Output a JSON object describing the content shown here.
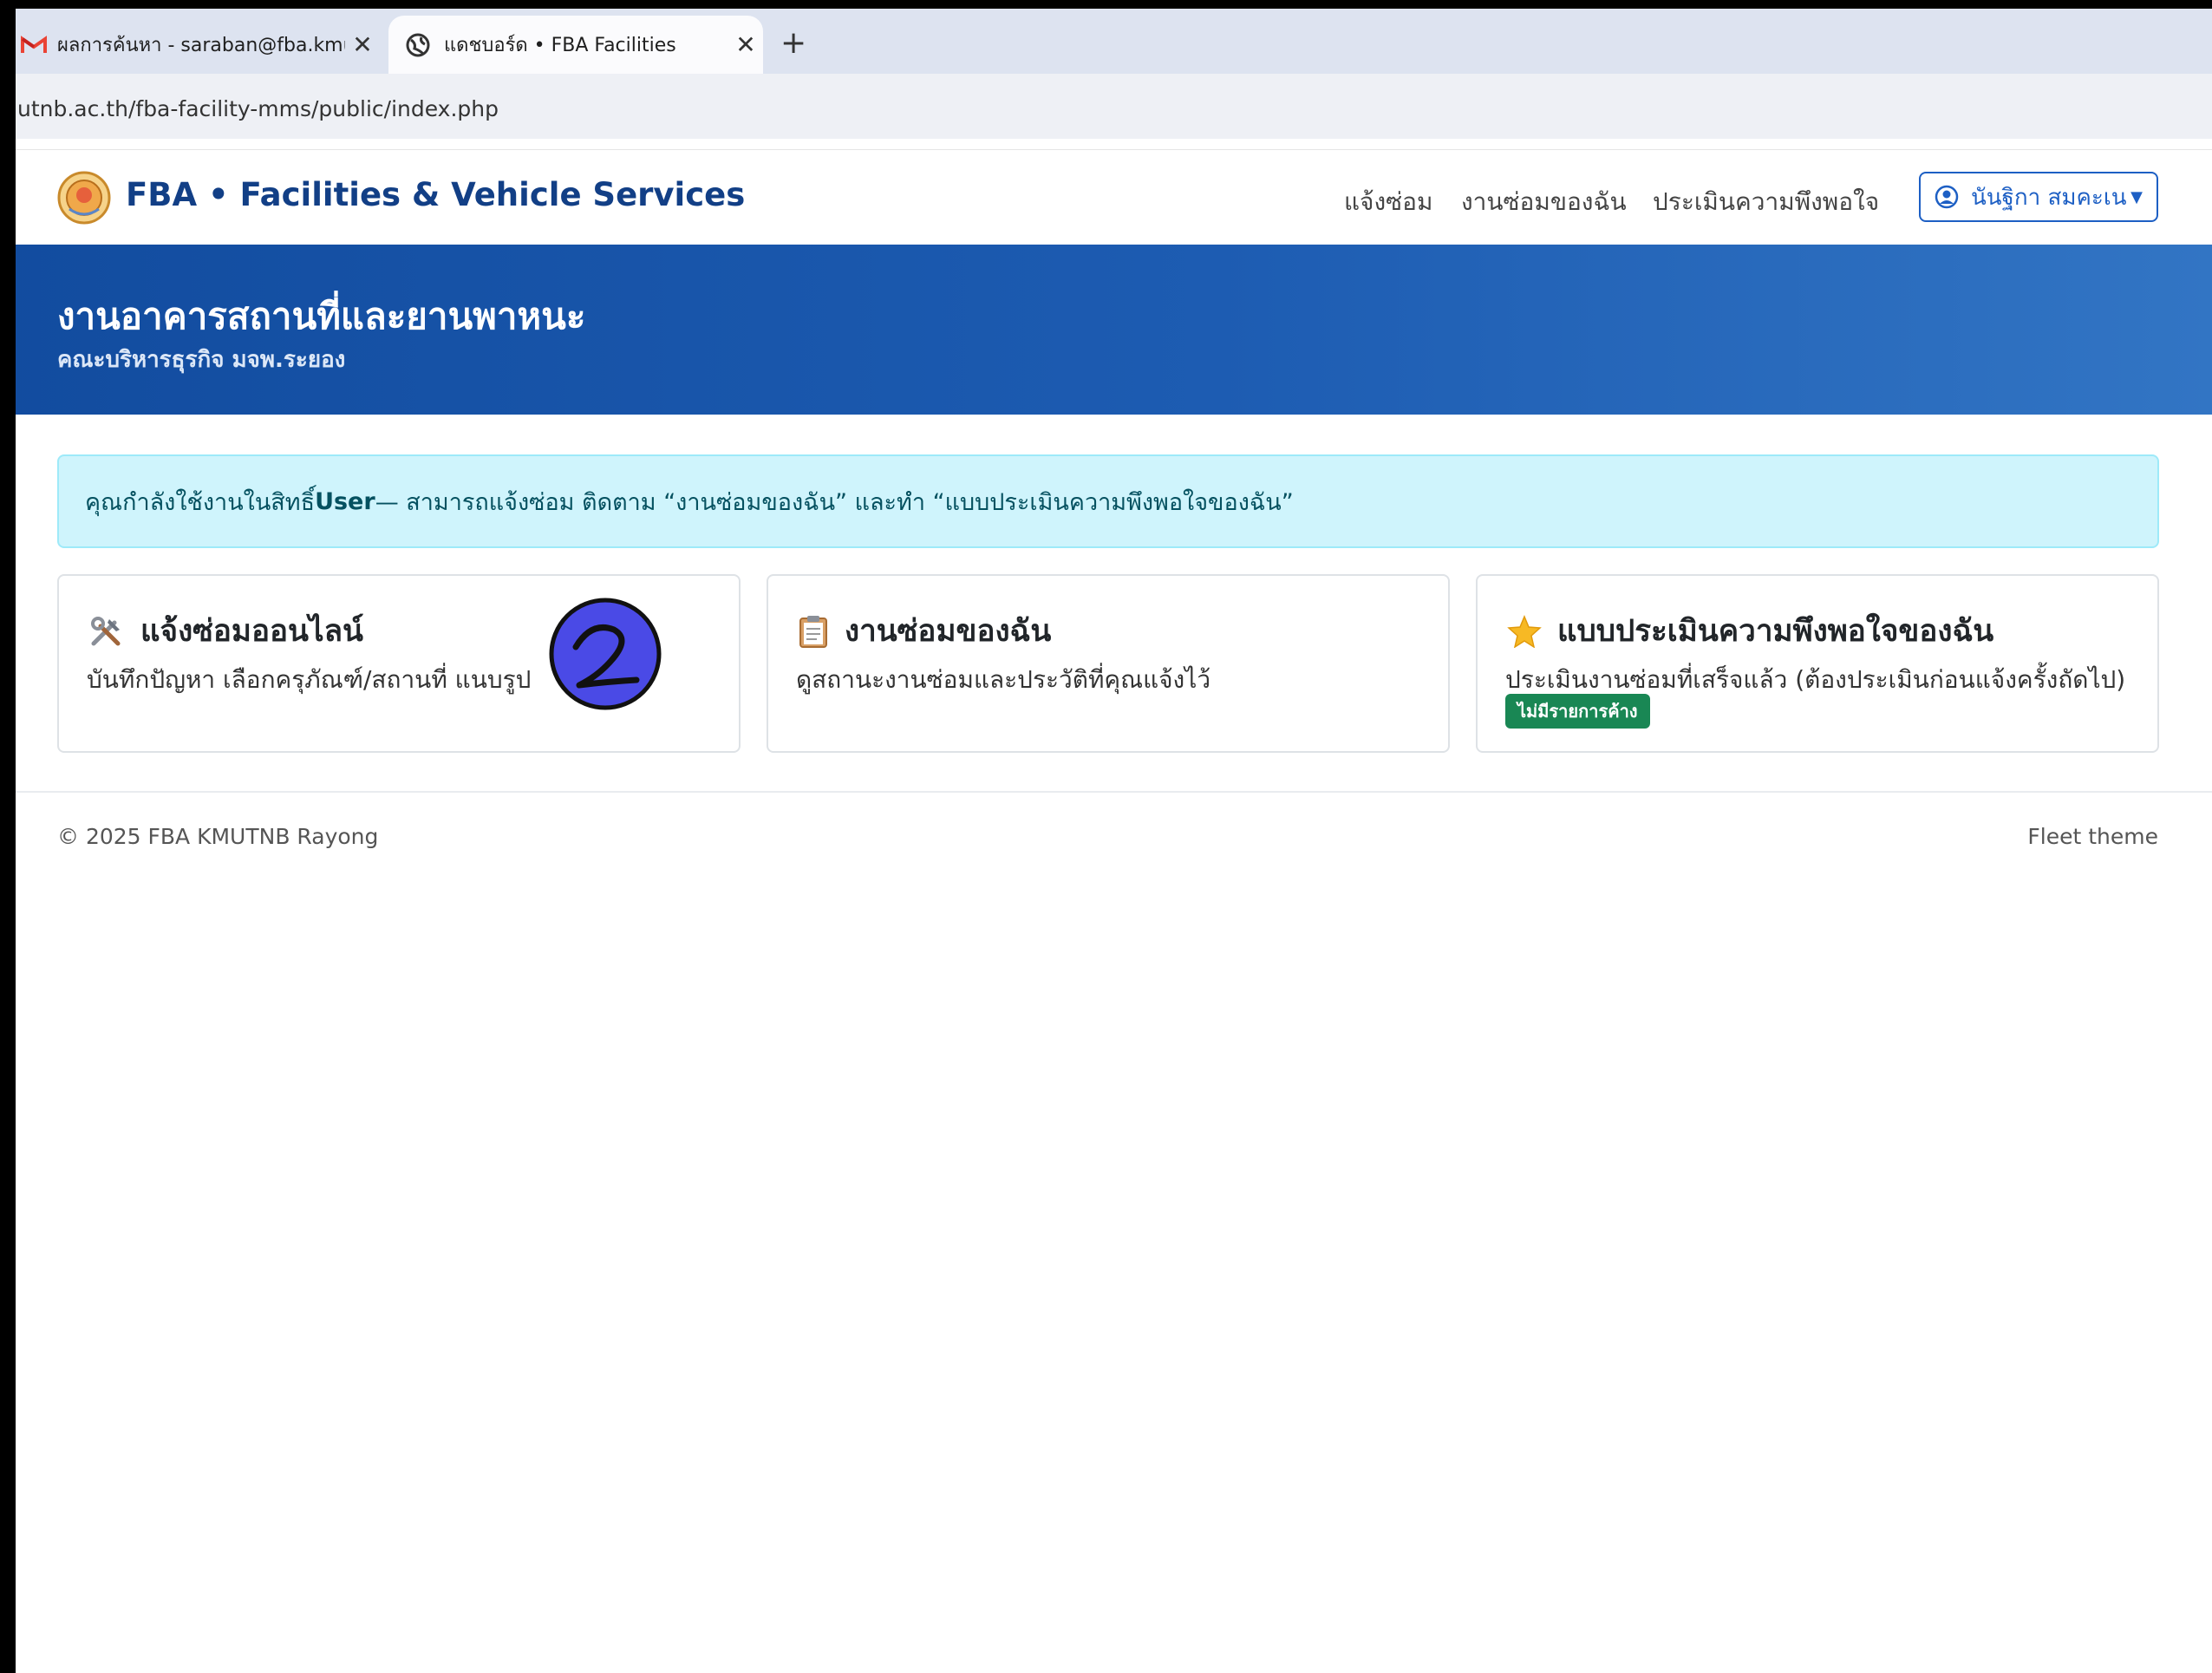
{
  "browser": {
    "tabs": [
      {
        "title": "ผลการค้นหา - saraban@fba.kmu",
        "icon": "gmail-icon"
      },
      {
        "title": "แดชบอร์ด • FBA Facilities",
        "icon": "globe-icon"
      }
    ],
    "close_glyph": "✕",
    "new_tab_glyph": "+",
    "url": "utnb.ac.th/fba-facility-mms/public/index.php"
  },
  "navbar": {
    "brand": "FBA • Facilities & Vehicle Services",
    "links": [
      "แจ้งซ่อม",
      "งานซ่อมของฉัน",
      "ประเมินความพึงพอใจ"
    ],
    "user_name": "นันฐิกา สมคะเน",
    "caret": "▼"
  },
  "hero": {
    "title": "งานอาคารสถานที่และยานพาหนะ",
    "subtitle": "คณะบริหารธุรกิจ มจพ.ระยอง"
  },
  "alert": {
    "prefix": "คุณกำลังใช้งานในสิทธิ์ ",
    "role": "User",
    "suffix": " — สามารถแจ้งซ่อม ติดตาม “งานซ่อมของฉัน” และทำ “แบบประเมินความพึงพอใจของฉัน”"
  },
  "cards": [
    {
      "title": "แจ้งซ่อมออนไลน์",
      "desc": "บันทึกปัญหา เลือกครุภัณฑ์/สถานที่ แนบรูป",
      "icon": "tools-icon"
    },
    {
      "title": "งานซ่อมของฉัน",
      "desc": "ดูสถานะงานซ่อมและประวัติที่คุณแจ้งไว้",
      "icon": "clipboard-icon"
    },
    {
      "title": "แบบประเมินความพึงพอใจของฉัน",
      "desc": "ประเมินงานซ่อมที่เสร็จแล้ว (ต้องประเมินก่อนแจ้งครั้งถัดไป)",
      "badge": "ไม่มีรายการค้าง",
      "icon": "star-icon"
    }
  ],
  "footer": {
    "copyright": "© 2025 FBA KMUTNB Rayong",
    "theme": "Fleet theme"
  },
  "colors": {
    "brand": "#123f86",
    "hero_start": "#124c9f",
    "alert_bg": "#cff4fc",
    "badge": "#198754",
    "annotation": "#4a4ae6"
  }
}
